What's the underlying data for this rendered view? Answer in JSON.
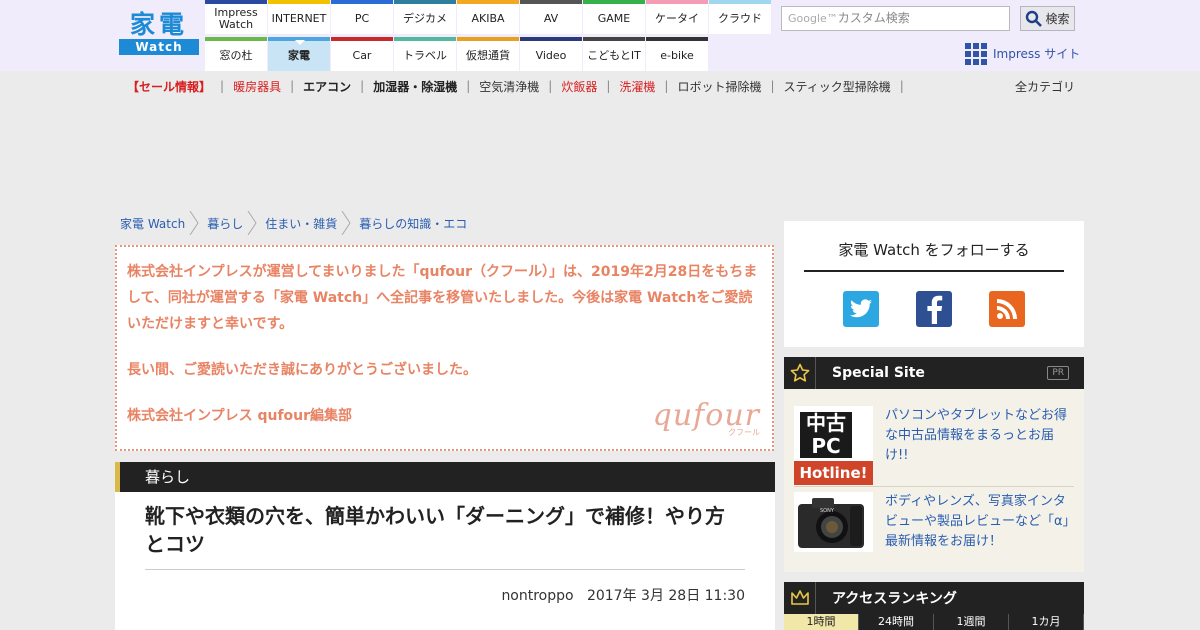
{
  "logo": {
    "kanji": "家電",
    "watch": "Watch"
  },
  "nav": [
    {
      "label": "Impress Watch",
      "color": "#2a4aa0"
    },
    {
      "label": "INTERNET",
      "color": "#f2c200"
    },
    {
      "label": "PC",
      "color": "#2b6bd6"
    },
    {
      "label": "デジカメ",
      "color": "#2e7e9e"
    },
    {
      "label": "AKIBA",
      "color": "#f2a820"
    },
    {
      "label": "AV",
      "color": "#555555"
    },
    {
      "label": "GAME",
      "color": "#35b04a"
    },
    {
      "label": "ケータイ",
      "color": "#f59bb5"
    },
    {
      "label": "クラウド",
      "color": "#9fd6f0"
    },
    {
      "label": "窓の杜",
      "color": "#6ab84a"
    },
    {
      "label": "家電",
      "color": "#4ea6e0",
      "active": true
    },
    {
      "label": "Car",
      "color": "#c82a2a"
    },
    {
      "label": "トラベル",
      "color": "#52b8a0"
    },
    {
      "label": "仮想通貨",
      "color": "#e8a020"
    },
    {
      "label": "Video",
      "color": "#2a3a7a"
    },
    {
      "label": "こどもとIT",
      "color": "#444444"
    },
    {
      "label": "e-bike",
      "color": "#333333"
    }
  ],
  "search": {
    "google_mark": "Google™",
    "placeholder": "カスタム検索",
    "button": "検索"
  },
  "impress_site": "Impress サイト",
  "categories": [
    {
      "label": "【セール情報】",
      "color": "#d81e1e",
      "bold": true
    },
    {
      "label": "暖房器具",
      "color": "#d81e1e"
    },
    {
      "label": "エアコン",
      "color": "#222222",
      "bold": true
    },
    {
      "label": "加湿器・除湿機",
      "color": "#222222",
      "bold": true
    },
    {
      "label": "空気清浄機",
      "color": "#333333"
    },
    {
      "label": "炊飯器",
      "color": "#d81e1e"
    },
    {
      "label": "洗濯機",
      "color": "#d81e1e"
    },
    {
      "label": "ロボット掃除機",
      "color": "#333333"
    },
    {
      "label": "スティック型掃除機",
      "color": "#333333"
    }
  ],
  "all_categories": "全カテゴリ",
  "breadcrumb": [
    "家電 Watch",
    "暮らし",
    "住まい・雑貨",
    "暮らしの知識・エコ"
  ],
  "notice": {
    "p1": "株式会社インプレスが運営してまいりました「qufour（クフール）」は、2019年2月28日をもちまして、同社が運営する「家電 Watch」へ全記事を移管いたしました。今後は家電 Watchをご愛読いただけますと幸いです。",
    "p2": "長い間、ご愛読いただき誠にありがとうございました。",
    "p3": "株式会社インプレス qufour編集部",
    "logo": "qufour",
    "logo_kana": "クフール"
  },
  "article": {
    "section": "暮らし",
    "title": "靴下や衣類の穴を、簡単かわいい「ダーニング」で補修！やり方とコツ",
    "author": "nontroppo",
    "date": "2017年 3月 28日 11:30"
  },
  "follow": {
    "title": "家電 Watch をフォローする"
  },
  "special": {
    "title": "Special Site",
    "pr": "PR",
    "items": [
      {
        "text": "パソコンやタブレットなどお得な中古品情報をまるっとお届け!!",
        "thumb_a": "中古PC",
        "thumb_b": "Hotline!"
      },
      {
        "text": "ボディやレンズ、写真家インタビューや製品レビューなど「α」最新情報をお届け！",
        "thumb_brand": "SONY"
      }
    ]
  },
  "ranking": {
    "title": "アクセスランキング",
    "tabs": [
      "1時間",
      "24時間",
      "1週間",
      "1カ月"
    ]
  }
}
